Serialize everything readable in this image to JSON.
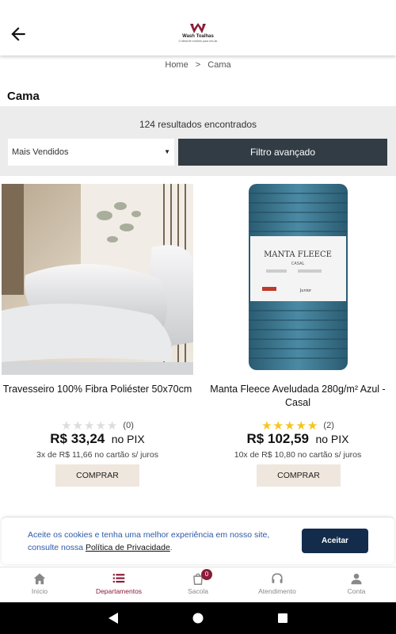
{
  "header": {
    "logo_name": "Wash Toalhas",
    "logo_tagline": "O ideal de conforto para seu lar",
    "colors": {
      "brand": "#8b1c38"
    }
  },
  "breadcrumb": {
    "home": "Home",
    "separator": ">",
    "current": "Cama"
  },
  "page_title": "Cama",
  "filters": {
    "results_count": "124 resultados encontrados",
    "sort_selected": "Mais Vendidos",
    "advanced_filter_label": "Filtro avançado"
  },
  "products": [
    {
      "name": "Travesseiro 100% Fibra Poliéster 50x70cm",
      "rating": 0,
      "rating_max": 5,
      "reviews": "(0)",
      "price": "R$ 33,24",
      "price_suffix": "no PIX",
      "installments": "3x de R$ 11,66 no cartão s/ juros",
      "buy_label": "COMPRAR"
    },
    {
      "name": "Manta Fleece Aveludada 280g/m² Azul - Casal",
      "rating": 5,
      "rating_max": 5,
      "reviews": "(2)",
      "price": "R$ 102,59",
      "price_suffix": "no PIX",
      "installments": "10x de R$ 10,80 no cartão s/ juros",
      "buy_label": "COMPRAR",
      "package_brand": "MANTA FLEECE",
      "package_size": "CASAL",
      "package_note": "Junior"
    }
  ],
  "cookie": {
    "text": "Aceite os cookies e tenha uma melhor experiência em nosso site, consulte nossa",
    "link": "Política de Privacidade",
    "after": ".",
    "accept_label": "Aceitar"
  },
  "bottom_nav": {
    "items": [
      {
        "label": "Início",
        "icon": "home-icon"
      },
      {
        "label": "Departamentos",
        "icon": "list-icon",
        "active": true
      },
      {
        "label": "Sacola",
        "icon": "bag-icon",
        "badge": "0"
      },
      {
        "label": "Atendimento",
        "icon": "headset-icon"
      },
      {
        "label": "Conta",
        "icon": "user-icon"
      }
    ]
  }
}
